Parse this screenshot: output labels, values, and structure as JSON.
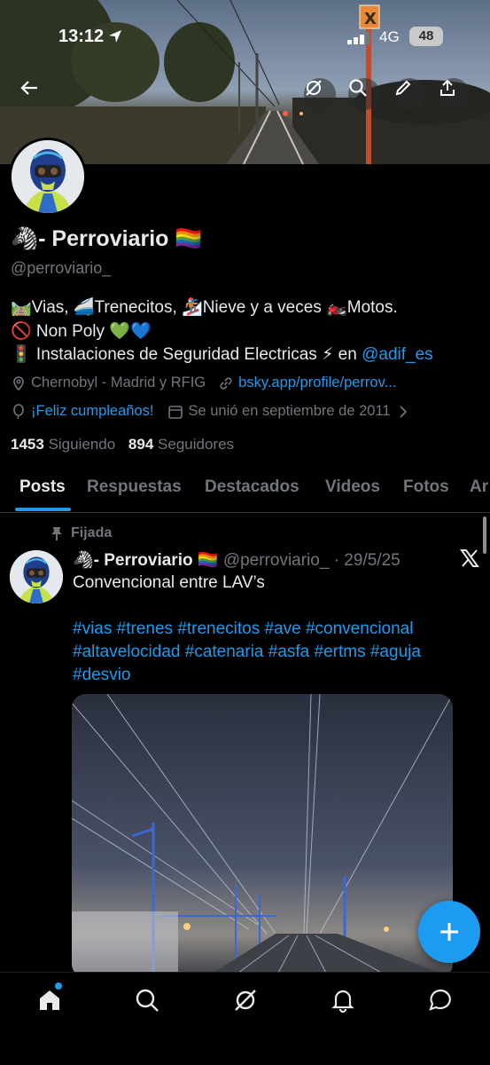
{
  "status_bar": {
    "time": "13:12",
    "network": "4G",
    "battery": "48"
  },
  "profile": {
    "display_name": "🦓- Perroviario 🏳️‍🌈",
    "handle": "@perroviario_",
    "bio_line1": "🛤️Vias, 🚄Trenecitos, 🏂Nieve y a veces 🏍️Motos.",
    "bio_line2": "🚫 Non Poly 💚💙",
    "bio_line3_prefix": "🚦 Instalaciones de Seguridad Electricas ⚡ en ",
    "bio_line3_mention": "@adif_es",
    "location": "Chernobyl - Madrid y RFIG",
    "website": "bsky.app/profile/perrov...",
    "birthday": "¡Feliz cumpleaños!",
    "joined": "Se unió en septiembre de 2011",
    "following_count": "1453",
    "following_label": "Siguiendo",
    "followers_count": "894",
    "followers_label": "Seguidores"
  },
  "tabs": [
    "Posts",
    "Respuestas",
    "Destacados",
    "Videos",
    "Fotos",
    "Ar"
  ],
  "post": {
    "pinned_label": "Fijada",
    "author": "🦓- Perroviario 🏳️‍🌈",
    "handle_date": "@perroviario_ · 29/5/25",
    "text": "Convencional entre LAV’s",
    "hashtags": "#vias #trenes #trenecitos #ave #convencional #altavelocidad #catenaria #asfa #ertms #aguja #desvio"
  },
  "colors": {
    "accent": "#1d9bf0",
    "muted": "#71767b",
    "text": "#e7e9ea",
    "background": "#000000"
  },
  "icons": [
    "back-arrow-icon",
    "grok-icon",
    "search-icon",
    "edit-icon",
    "share-icon",
    "location-icon",
    "link-icon",
    "balloon-icon",
    "calendar-icon",
    "pin-icon",
    "x-logo-icon",
    "plus-icon",
    "home-icon",
    "explore-icon",
    "grok-nav-icon",
    "bell-icon",
    "messages-icon"
  ]
}
